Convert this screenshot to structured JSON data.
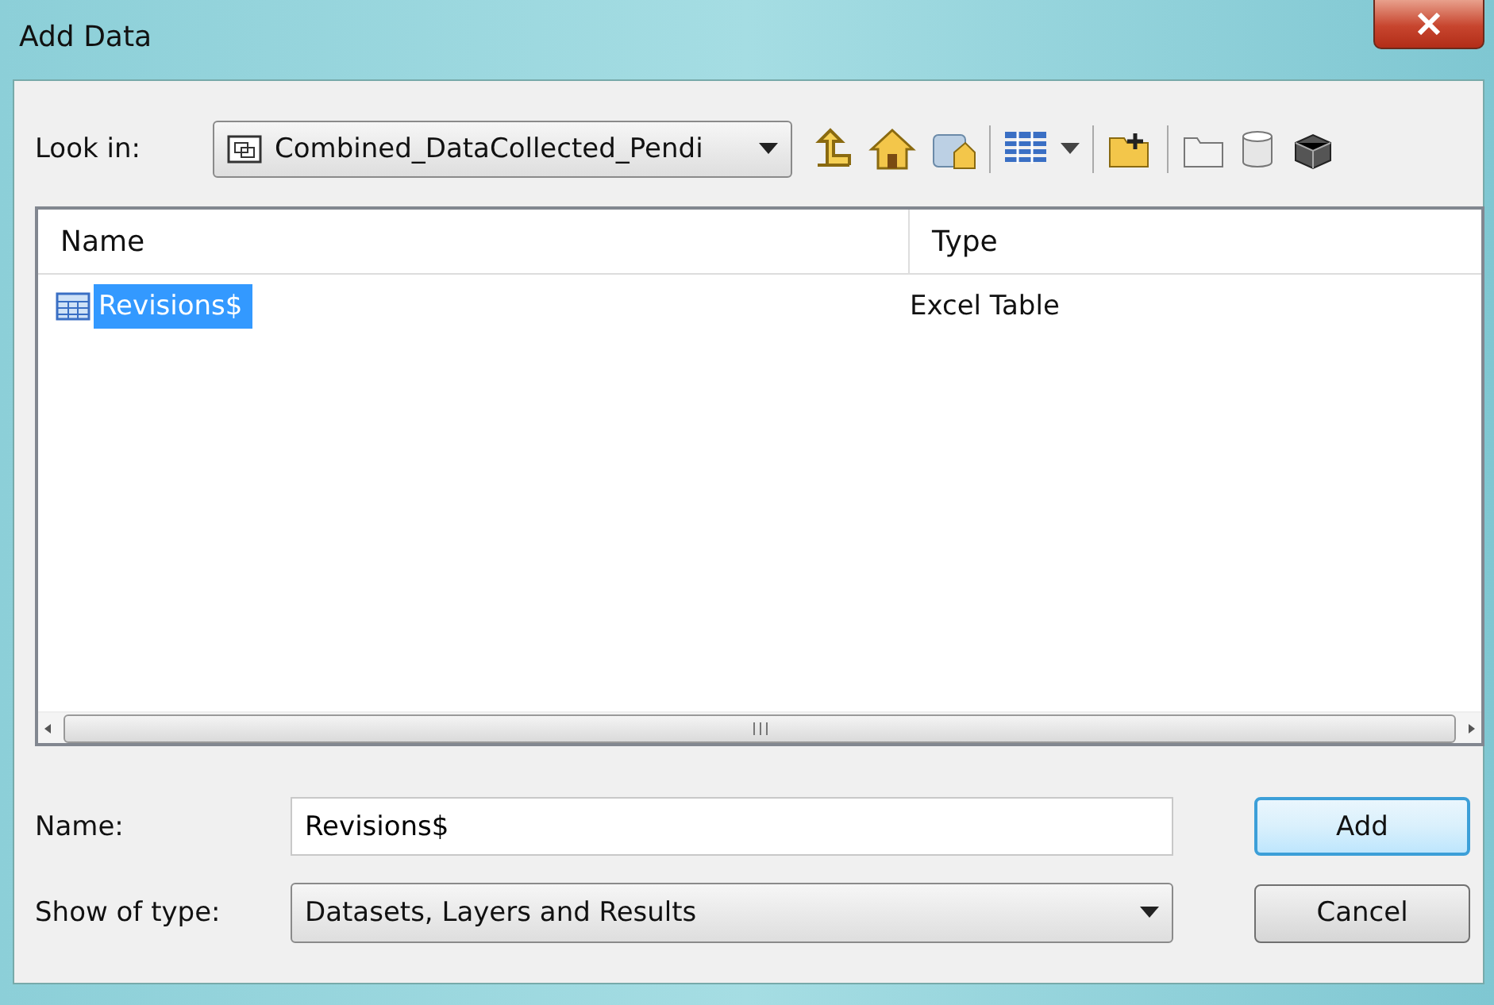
{
  "window": {
    "title": "Add Data"
  },
  "look_in": {
    "label": "Look in:",
    "value": "Combined_DataCollected_Pendi"
  },
  "table": {
    "columns": [
      "Name",
      "Type"
    ],
    "rows": [
      {
        "name": "Revisions$",
        "type": "Excel Table",
        "selected": true
      }
    ]
  },
  "name_field": {
    "label": "Name:",
    "value": "Revisions$"
  },
  "type_field": {
    "label": "Show of type:",
    "value": "Datasets, Layers and Results"
  },
  "buttons": [
    {
      "label": "Add",
      "kind": "default"
    },
    {
      "label": "Cancel",
      "kind": "normal"
    }
  ]
}
